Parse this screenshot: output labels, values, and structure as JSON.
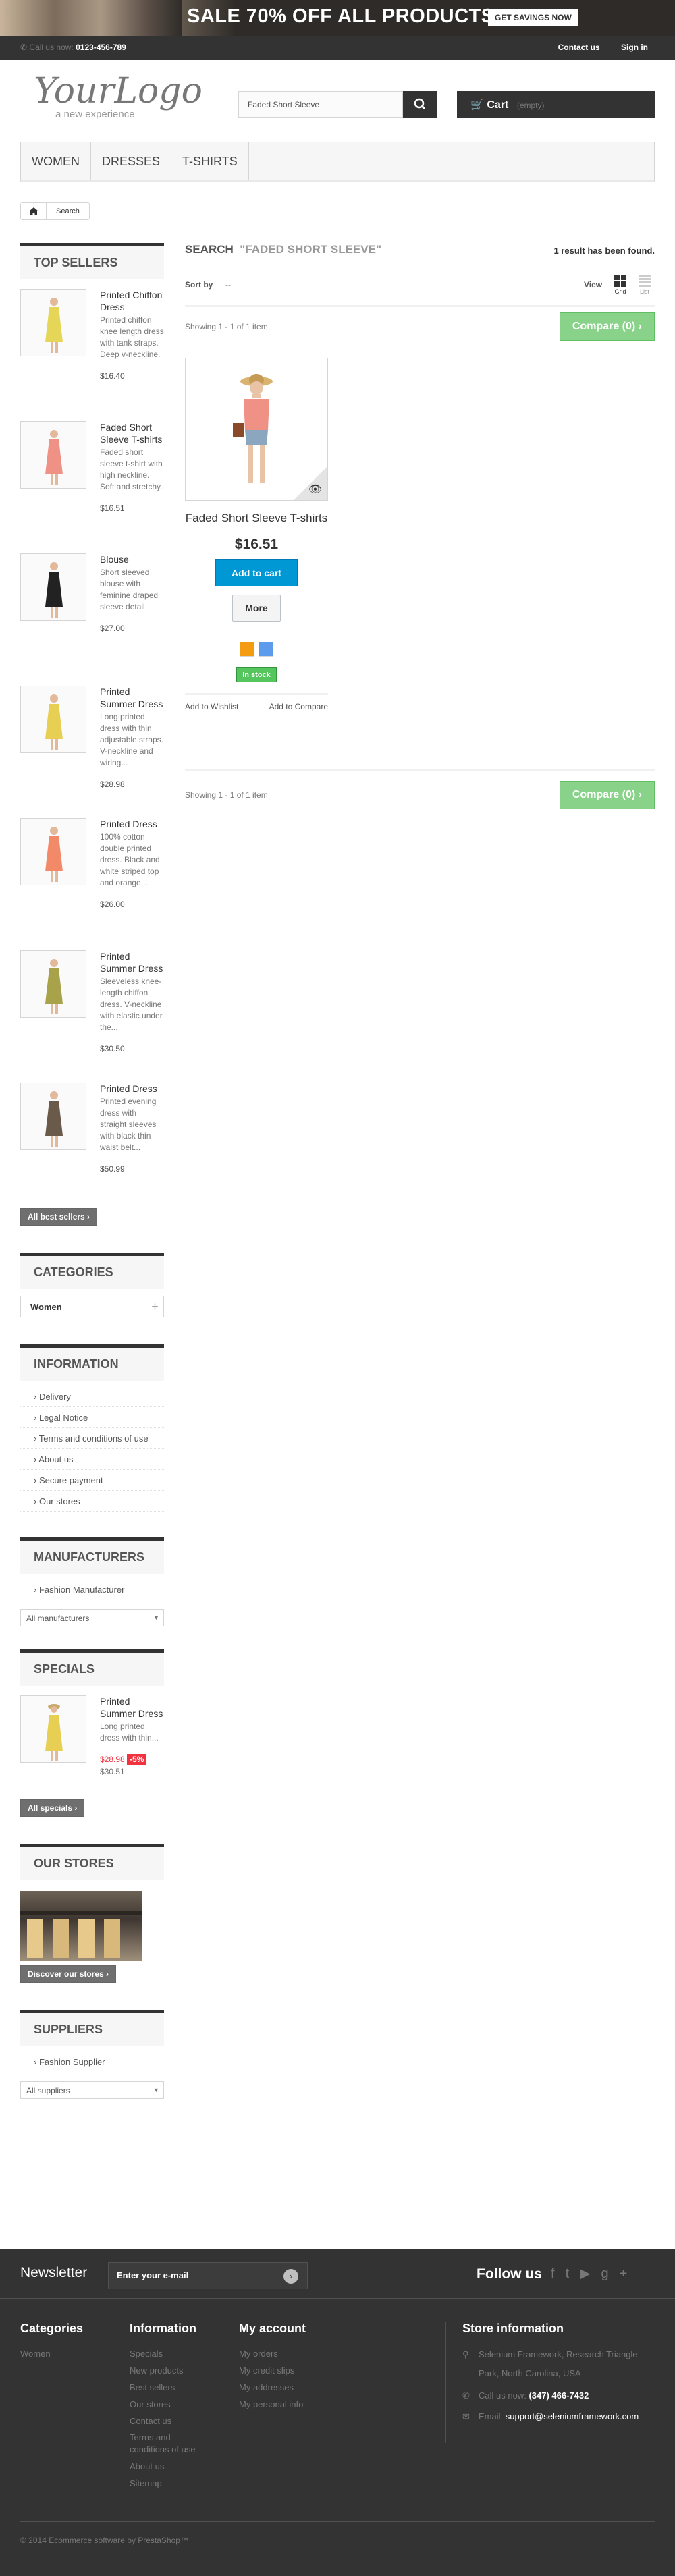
{
  "banner": {
    "sale": "SALE 70% OFF ALL PRODUCTS",
    "cta": "GET SAVINGS NOW"
  },
  "topbar": {
    "call_label": "Call us now:",
    "phone": "0123-456-789",
    "contact": "Contact us",
    "signin": "Sign in"
  },
  "logo": {
    "name": "YourLogo",
    "tagline": "a new experience"
  },
  "search": {
    "value": "Faded Short Sleeve"
  },
  "cart": {
    "label": "Cart",
    "status": "(empty)"
  },
  "menu": {
    "items": [
      "Women",
      "Dresses",
      "T-shirts"
    ]
  },
  "breadcrumb": {
    "current": "Search"
  },
  "top_sellers": {
    "title": "Top sellers",
    "items": [
      {
        "name": "Printed Chiffon Dress",
        "desc": "Printed chiffon knee length dress with tank straps. Deep v-neckline.",
        "price": "$16.40"
      },
      {
        "name": "Faded Short Sleeve T-shirts",
        "desc": "Faded short sleeve t-shirt with high neckline. Soft and stretchy.",
        "price": "$16.51"
      },
      {
        "name": "Blouse",
        "desc": "Short sleeved blouse with feminine draped sleeve detail.",
        "price": "$27.00"
      },
      {
        "name": "Printed Summer Dress",
        "desc": "Long printed dress with thin adjustable straps. V-neckline and wiring...",
        "price": "$28.98"
      },
      {
        "name": "Printed Dress",
        "desc": "100% cotton double printed dress. Black and white striped top and orange...",
        "price": "$26.00"
      },
      {
        "name": "Printed Summer Dress",
        "desc": "Sleeveless knee-length chiffon dress. V-neckline with elastic under the...",
        "price": "$30.50"
      },
      {
        "name": "Printed Dress",
        "desc": "Printed evening dress with straight sleeves with black thin waist belt...",
        "price": "$50.99"
      }
    ],
    "all_label": "All best sellers"
  },
  "categories": {
    "title": "Categories",
    "item": "Women"
  },
  "information": {
    "title": "Information",
    "items": [
      "Delivery",
      "Legal Notice",
      "Terms and conditions of use",
      "About us",
      "Secure payment",
      "Our stores"
    ]
  },
  "manufacturers": {
    "title": "Manufacturers",
    "item": "Fashion Manufacturer",
    "select": "All manufacturers"
  },
  "specials": {
    "title": "Specials",
    "name": "Printed Summer Dress",
    "desc": "Long printed dress with thin...",
    "price": "$28.98",
    "discount": "-5%",
    "old_price": "$30.51",
    "all_label": "All specials"
  },
  "stores": {
    "title": "Our stores",
    "cta": "Discover our stores"
  },
  "suppliers": {
    "title": "Suppliers",
    "item": "Fashion Supplier",
    "select": "All suppliers"
  },
  "results": {
    "heading": "Search",
    "query": "\"Faded Short Sleeve\"",
    "found": "1 result has been found.",
    "sort_label": "Sort by",
    "sort_value": "--",
    "view_label": "View",
    "grid": "Grid",
    "list": "List",
    "showing": "Showing 1 - 1 of 1 item",
    "compare": "Compare (0)"
  },
  "product": {
    "name": "Faded Short Sleeve T-shirts",
    "price": "$16.51",
    "add_to_cart": "Add to cart",
    "more": "More",
    "stock": "In stock",
    "wishlist": "Add to Wishlist",
    "compare": "Add to Compare",
    "colors": [
      "#f39c11",
      "#5d9cec"
    ]
  },
  "footer": {
    "newsletter": "Newsletter",
    "email_placeholder": "Enter your e-mail",
    "follow": "Follow us",
    "categories_title": "Categories",
    "categories": [
      "Women"
    ],
    "information_title": "Information",
    "information": [
      "Specials",
      "New products",
      "Best sellers",
      "Our stores",
      "Contact us",
      "Terms and conditions of use",
      "About us",
      "Sitemap"
    ],
    "account_title": "My account",
    "account": [
      "My orders",
      "My credit slips",
      "My addresses",
      "My personal info"
    ],
    "store_title": "Store information",
    "address": "Selenium Framework, Research Triangle Park, North Carolina, USA",
    "call_label": "Call us now:",
    "phone": "(347) 466-7432",
    "email_label": "Email:",
    "email": "support@seleniumframework.com",
    "copyright": "© 2014 Ecommerce software by PrestaShop™"
  }
}
